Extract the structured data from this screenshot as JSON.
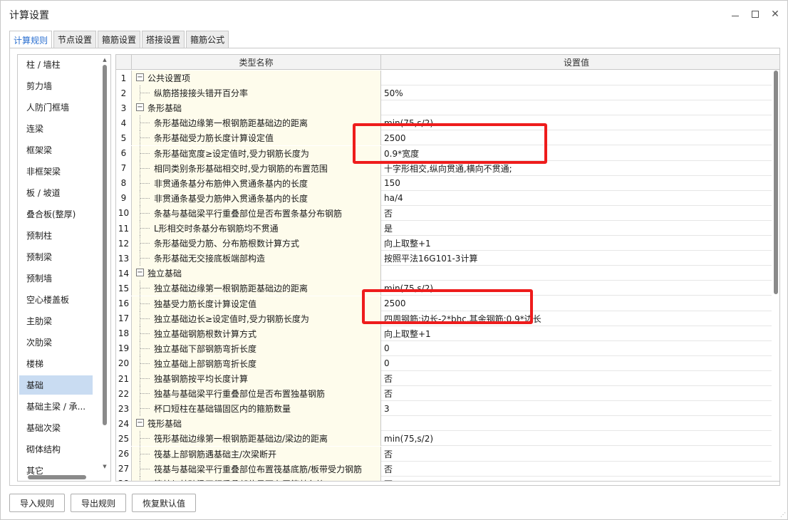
{
  "window": {
    "title": "计算设置"
  },
  "tabs": [
    {
      "label": "计算规则",
      "active": true
    },
    {
      "label": "节点设置",
      "active": false
    },
    {
      "label": "箍筋设置",
      "active": false
    },
    {
      "label": "搭接设置",
      "active": false
    },
    {
      "label": "箍筋公式",
      "active": false
    }
  ],
  "sidebar": {
    "items": [
      "柱 / 墙柱",
      "剪力墙",
      "人防门框墙",
      "连梁",
      "框架梁",
      "非框架梁",
      "板 / 坡道",
      "叠合板(整厚)",
      "预制柱",
      "预制梁",
      "预制墙",
      "空心楼盖板",
      "主肋梁",
      "次肋梁",
      "楼梯",
      "基础",
      "基础主梁 / 承...",
      "基础次梁",
      "砌体结构",
      "其它"
    ],
    "active_index": 15
  },
  "grid": {
    "headers": {
      "name": "类型名称",
      "value": "设置值"
    },
    "rows": [
      {
        "n": "1",
        "name": "公共设置项",
        "value": "",
        "group": true
      },
      {
        "n": "2",
        "name": "纵筋搭接接头错开百分率",
        "value": "50%",
        "group": false
      },
      {
        "n": "3",
        "name": "条形基础",
        "value": "",
        "group": true
      },
      {
        "n": "4",
        "name": "条形基础边缘第一根钢筋距基础边的距离",
        "value": "min(75,s/2)",
        "group": false
      },
      {
        "n": "5",
        "name": "条形基础受力筋长度计算设定值",
        "value": "2500",
        "group": false
      },
      {
        "n": "6",
        "name": "条形基础宽度≥设定值时,受力钢筋长度为",
        "value": "0.9*宽度",
        "group": false
      },
      {
        "n": "7",
        "name": "相同类别条形基础相交时,受力钢筋的布置范围",
        "value": "十字形相交,纵向贯通,横向不贯通;",
        "group": false
      },
      {
        "n": "8",
        "name": "非贯通条基分布筋伸入贯通条基内的长度",
        "value": "150",
        "group": false
      },
      {
        "n": "9",
        "name": "非贯通条基受力筋伸入贯通条基内的长度",
        "value": "ha/4",
        "group": false
      },
      {
        "n": "10",
        "name": "条基与基础梁平行重叠部位是否布置条基分布钢筋",
        "value": "否",
        "group": false
      },
      {
        "n": "11",
        "name": "L形相交时条基分布钢筋均不贯通",
        "value": "是",
        "group": false
      },
      {
        "n": "12",
        "name": "条形基础受力筋、分布筋根数计算方式",
        "value": "向上取整+1",
        "group": false
      },
      {
        "n": "13",
        "name": "条形基础无交接底板端部构造",
        "value": "按照平法16G101-3计算",
        "group": false
      },
      {
        "n": "14",
        "name": "独立基础",
        "value": "",
        "group": true
      },
      {
        "n": "15",
        "name": "独立基础边缘第一根钢筋距基础边的距离",
        "value": "min(75,s/2)",
        "group": false
      },
      {
        "n": "16",
        "name": "独基受力筋长度计算设定值",
        "value": "2500",
        "group": false
      },
      {
        "n": "17",
        "name": "独立基础边长≥设定值时,受力钢筋长度为",
        "value": "四周钢筋:边长-2*bhc,其余钢筋:0.9*边长",
        "group": false
      },
      {
        "n": "18",
        "name": "独立基础钢筋根数计算方式",
        "value": "向上取整+1",
        "group": false
      },
      {
        "n": "19",
        "name": "独立基础下部钢筋弯折长度",
        "value": "0",
        "group": false
      },
      {
        "n": "20",
        "name": "独立基础上部钢筋弯折长度",
        "value": "0",
        "group": false
      },
      {
        "n": "21",
        "name": "独基钢筋按平均长度计算",
        "value": "否",
        "group": false
      },
      {
        "n": "22",
        "name": "独基与基础梁平行重叠部位是否布置独基钢筋",
        "value": "否",
        "group": false
      },
      {
        "n": "23",
        "name": "杯口短柱在基础锚固区内的箍筋数量",
        "value": "3",
        "group": false
      },
      {
        "n": "24",
        "name": "筏形基础",
        "value": "",
        "group": true
      },
      {
        "n": "25",
        "name": "筏形基础边缘第一根钢筋距基础边/梁边的距离",
        "value": "min(75,s/2)",
        "group": false
      },
      {
        "n": "26",
        "name": "筏基上部钢筋遇基础主/次梁断开",
        "value": "否",
        "group": false
      },
      {
        "n": "27",
        "name": "筏基与基础梁平行重叠部位布置筏基底筋/板带受力钢筋",
        "value": "否",
        "group": false
      },
      {
        "n": "28",
        "name": "筏基与基础梁平行重叠部位是否布置筏基负筋",
        "value": "否",
        "group": false
      }
    ]
  },
  "footer": {
    "import_label": "导入规则",
    "export_label": "导出规则",
    "restore_label": "恢复默认值"
  },
  "colors": {
    "accent": "#2a6fd0",
    "highlight": "#ee1c1c",
    "name_cell_bg": "#fefcec",
    "selected_bg": "#c9dcf2"
  }
}
